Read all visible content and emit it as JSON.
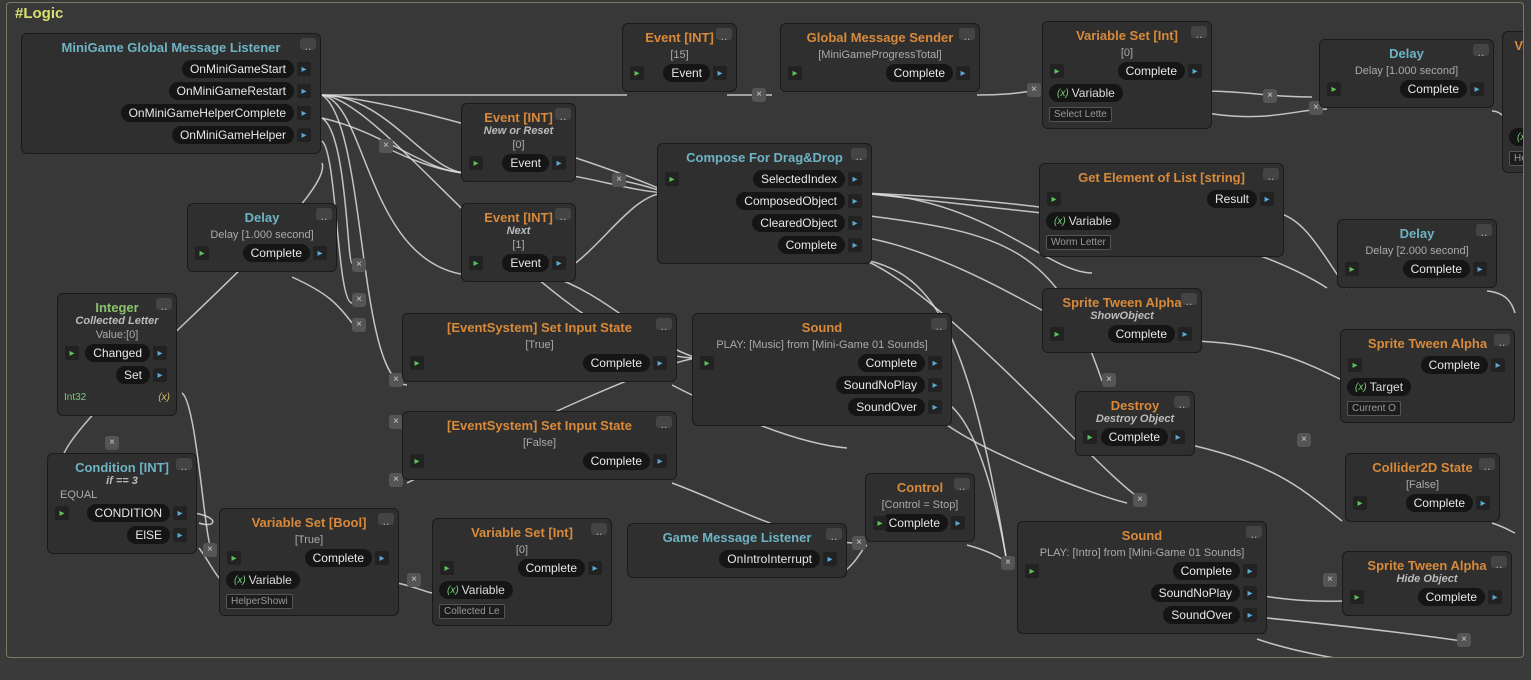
{
  "canvas": {
    "title": "#Logic"
  },
  "nodes": {
    "listener": {
      "title": "MiniGame Global Message Listener",
      "ports": [
        "OnMiniGameStart",
        "OnMiniGameRestart",
        "OnMiniGameHelperComplete",
        "OnMiniGameHelper"
      ]
    },
    "delay1": {
      "title": "Delay",
      "info": "Delay [1.000 second]",
      "out": "Complete"
    },
    "integer": {
      "title": "Integer",
      "subtitle": "Collected Letter",
      "info": "Value:[0]",
      "p1": "Changed",
      "p2": "Set",
      "type": "Int32"
    },
    "condition": {
      "title": "Condition [INT]",
      "subtitle": "if == 3",
      "info": "EQUAL",
      "p1": "CONDITION",
      "p2": "ElSE"
    },
    "varsetBool": {
      "title": "Variable Set [Bool]",
      "info": "[True]",
      "out": "Complete",
      "var": "Variable",
      "field": "HelperShowi"
    },
    "varsetInt2": {
      "title": "Variable Set [Int]",
      "info": "[0]",
      "out": "Complete",
      "var": "Variable",
      "field": "Collected Le"
    },
    "eventInt15": {
      "title": "Event [INT]",
      "info": "[15]",
      "out": "Event"
    },
    "eventIntNew": {
      "title": "Event [INT]",
      "subtitle": "New or Reset",
      "info": "[0]",
      "out": "Event"
    },
    "eventIntNext": {
      "title": "Event [INT]",
      "subtitle": "Next",
      "info": "[1]",
      "out": "Event"
    },
    "inputTrue": {
      "title": "[EventSystem] Set Input State",
      "info": "[True]",
      "out": "Complete"
    },
    "inputFalse": {
      "title": "[EventSystem] Set Input State",
      "info": "[False]",
      "out": "Complete"
    },
    "gmsender": {
      "title": "Global Message Sender",
      "info": "[MiniGameProgressTotal]",
      "out": "Complete"
    },
    "compose": {
      "title": "Compose For Drag&Drop",
      "p1": "SelectedIndex",
      "p2": "ComposedObject",
      "p3": "ClearedObject",
      "p4": "Complete"
    },
    "soundMusic": {
      "title": "Sound",
      "info": "PLAY: [Music] from [Mini-Game 01 Sounds]",
      "p1": "Complete",
      "p2": "SoundNoPlay",
      "p3": "SoundOver"
    },
    "gameMsg": {
      "title": "Game Message Listener",
      "out": "OnIntroInterrupt"
    },
    "control": {
      "title": "Control",
      "info": "[Control = Stop]",
      "out": "Complete"
    },
    "varsetInt0": {
      "title": "Variable Set [Int]",
      "info": "[0]",
      "out": "Complete",
      "var": "Variable",
      "field": "Select Lette"
    },
    "getElem": {
      "title": "Get Element of List [string]",
      "out": "Result",
      "var": "Variable",
      "field": "Worm Letter"
    },
    "tweenShow": {
      "title": "Sprite Tween Alpha",
      "subtitle": "ShowObject",
      "out": "Complete"
    },
    "destroy": {
      "title": "Destroy",
      "subtitle": "Destroy Object",
      "out": "Complete"
    },
    "soundIntro": {
      "title": "Sound",
      "info": "PLAY: [Intro] from [Mini-Game 01 Sounds]",
      "p1": "Complete",
      "p2": "SoundNoPlay",
      "p3": "SoundOver"
    },
    "delayTop": {
      "title": "Delay",
      "info": "Delay [1.000 second]",
      "out": "Complete"
    },
    "delay2s": {
      "title": "Delay",
      "info": "Delay [2.000 second]",
      "out": "Complete"
    },
    "tweenAlpha2": {
      "title": "Sprite Tween Alpha",
      "out": "Complete",
      "tgt": "Target",
      "field": "Current O"
    },
    "collider": {
      "title": "Collider2D State",
      "info": "[False]",
      "out": "Complete"
    },
    "tweenHide": {
      "title": "Sprite Tween Alpha",
      "subtitle": "Hide Object",
      "out": "Complete"
    },
    "varCut": {
      "title": "Va",
      "var": "Va",
      "field": "Helpe"
    }
  }
}
